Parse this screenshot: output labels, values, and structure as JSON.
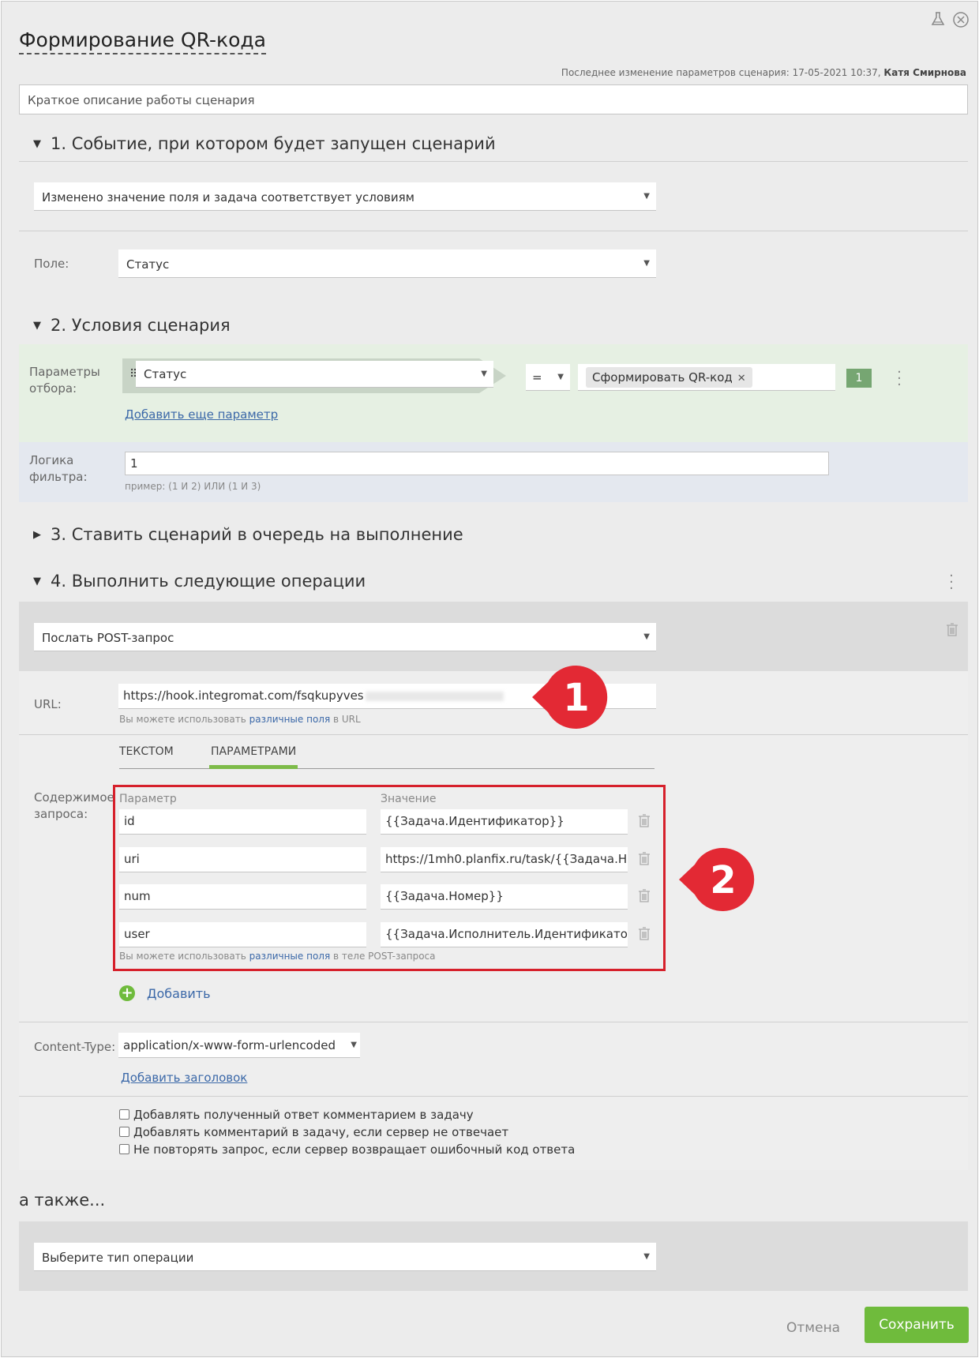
{
  "header": {
    "title": "Формирование QR-кода",
    "last_modified_prefix": "Последнее изменение параметров сценария: 17-05-2021 10:37,",
    "last_modified_user": "Катя Смирнова",
    "description_placeholder": "Краткое описание работы сценария"
  },
  "section1": {
    "title": "1. Событие, при котором будет запущен сценарий",
    "event_value": "Изменено значение поля и задача соответствует условиям",
    "field_label": "Поле:",
    "field_value": "Статус"
  },
  "section2": {
    "title": "2. Условия сценария",
    "params_label_line1": "Параметры",
    "params_label_line2": "отбора:",
    "param_field": "Статус",
    "operator": "=",
    "value_tag": "Сформировать QR-код",
    "param_number": "1",
    "add_param_link": "Добавить еще параметр",
    "logic_label_line1": "Логика",
    "logic_label_line2": "фильтра:",
    "logic_value": "1",
    "logic_hint": "пример: (1 И 2) ИЛИ (1 И 3)"
  },
  "section3": {
    "title": "3. Ставить сценарий в очередь на выполнение"
  },
  "section4": {
    "title": "4. Выполнить следующие операции",
    "operation_value": "Послать POST-запрос",
    "url_label": "URL:",
    "url_value": "https://hook.integromat.com/fsqkupyves",
    "url_hint_prefix": "Вы можете использовать",
    "url_hint_link": "различные поля",
    "url_hint_suffix": "в URL",
    "tab_text": "ТЕКСТОМ",
    "tab_params": "ПАРАМЕТРАМИ",
    "body_label_line1": "Содержимое",
    "body_label_line2": "запроса:",
    "col_param": "Параметр",
    "col_value": "Значение",
    "rows": [
      {
        "param": "id",
        "value": "{{Задача.Идентификатор}}"
      },
      {
        "param": "uri",
        "value": "https://1mh0.planfix.ru/task/{{Задача.Н"
      },
      {
        "param": "num",
        "value": "{{Задача.Номер}}"
      },
      {
        "param": "user",
        "value": "{{Задача.Исполнитель.Идентификатор}}"
      }
    ],
    "body_hint_prefix": "Вы можете использовать",
    "body_hint_link": "различные поля",
    "body_hint_suffix": "в теле POST-запроса",
    "add_label": "Добавить",
    "content_type_label": "Content-Type:",
    "content_type_value": "application/x-www-form-urlencoded",
    "add_header_link": "Добавить заголовок",
    "checkboxes": [
      "Добавлять полученный ответ комментарием в задачу",
      "Добавлять комментарий в задачу, если сервер не отвечает",
      "Не повторять запрос, если сервер возвращает ошибочный код ответа"
    ]
  },
  "markers": [
    "1",
    "2"
  ],
  "also": {
    "title": "а также...",
    "select_placeholder": "Выберите тип операции"
  },
  "footer": {
    "cancel": "Отмена",
    "save": "Сохранить"
  },
  "colors": {
    "accent_green": "#6fbb3c",
    "marker_red": "#e32934",
    "highlight_red": "#d6202b",
    "link_blue": "#3b68a8"
  }
}
